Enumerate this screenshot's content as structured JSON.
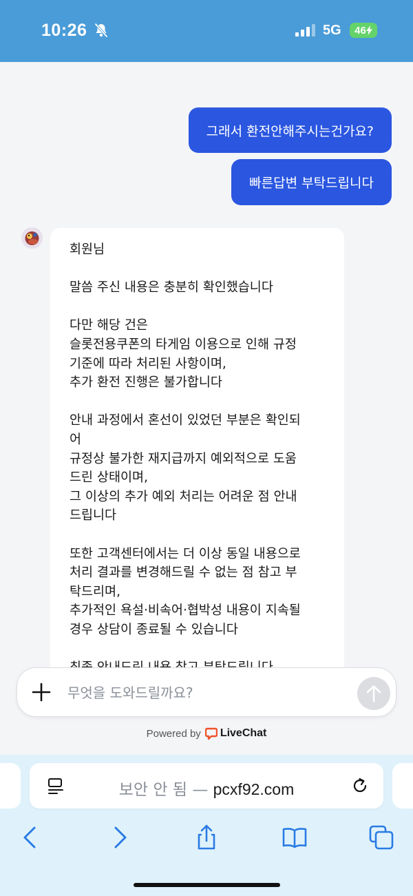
{
  "status_bar": {
    "time": "10:26",
    "network": "5G",
    "battery": "46",
    "colors": {
      "background": "#4a9cd8",
      "battery": "#64d36a"
    }
  },
  "chat": {
    "user_messages": [
      "그래서 환전안해주시는건가요?",
      "빠른답변 부탁드립니다"
    ],
    "agent_message_lines": [
      "회원님",
      "",
      "말씀 주신 내용은 충분히 확인했습니다",
      "",
      "다만 해당 건은",
      "슬롯전용쿠폰의 타게임 이용으로 인해 규정",
      "기준에 따라 처리된 사항이며,",
      "추가 환전 진행은 불가합니다",
      "",
      "안내 과정에서 혼선이 있었던 부분은 확인되",
      "어",
      "규정상 불가한 재지급까지 예외적으로 도움",
      "드린 상태이며,",
      "그 이상의 추가 예외 처리는 어려운 점 안내",
      "드립니다",
      "",
      "또한 고객센터에서는 더 이상 동일 내용으로",
      "처리 결과를 변경해드릴 수 없는 점 참고 부",
      "탁드리며,",
      "추가적인 욕설·비속어·협박성 내용이 지속될",
      "경우 상담이 종료될 수 있습니다",
      "",
      "최종 안내드린 내용 참고 부탁드립니다"
    ],
    "colors": {
      "user_bubble": "#2a56e0",
      "agent_bubble": "#ffffff"
    }
  },
  "composer": {
    "placeholder": "무엇을 도와드릴까요?",
    "value": ""
  },
  "footer": {
    "powered_by": "Powered by",
    "brand": "LiveChat",
    "brand_color": "#f0522b"
  },
  "browser": {
    "url_prefix": "보안 안 됨 — ",
    "url_domain": "pcxf92.com",
    "nav_icons": [
      "back-icon",
      "forward-icon",
      "share-icon",
      "bookmarks-icon",
      "tabs-icon"
    ]
  }
}
